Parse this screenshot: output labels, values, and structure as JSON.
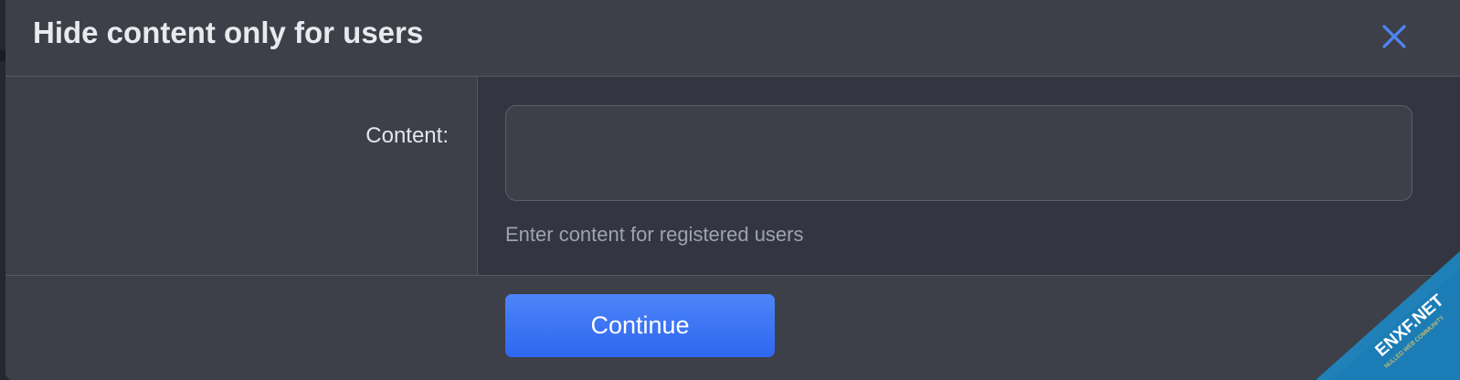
{
  "dialog": {
    "title": "Hide content only for users",
    "close_icon": "close-icon"
  },
  "form": {
    "content_label": "Content:",
    "content_value": "",
    "content_hint": "Enter content for registered users"
  },
  "footer": {
    "continue_label": "Continue"
  },
  "watermark": {
    "brand": "ENXF.NET",
    "tagline": "NULLED WEB COMMUNITY"
  },
  "colors": {
    "accent": "#2f66f1",
    "close_icon": "#4f86f7",
    "dialog_bg": "#3d4049",
    "input_panel_bg": "#333640",
    "watermark_ribbon": "#1d88c4"
  }
}
